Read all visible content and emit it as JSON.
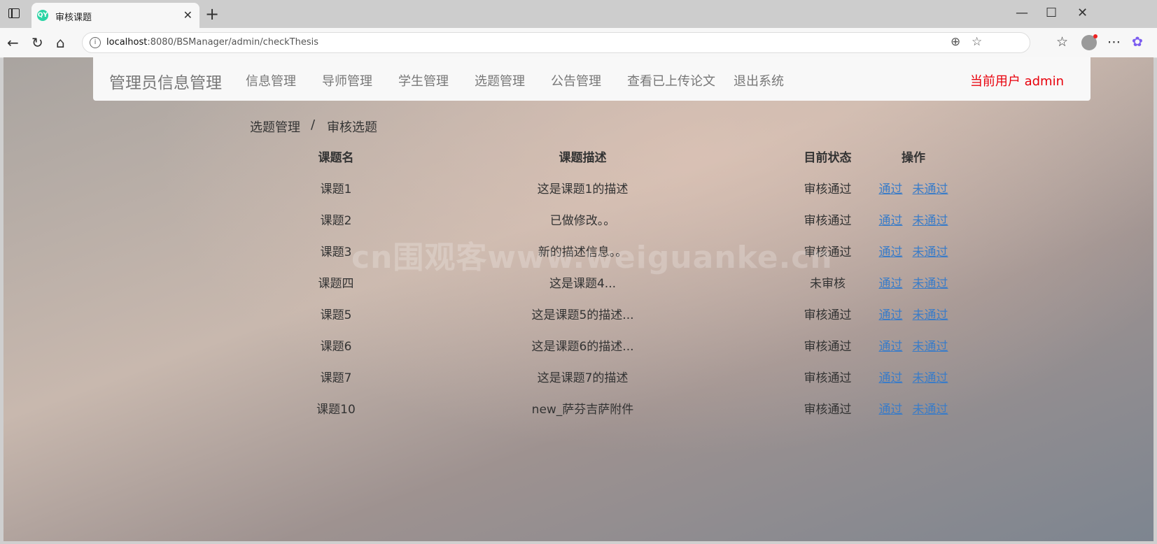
{
  "browser": {
    "tab_title": "审核课题",
    "favicon_text": "QY",
    "url_host": "localhost",
    "url_rest": ":8080/BSManager/admin/checkThesis"
  },
  "nav": {
    "brand": "管理员信息管理",
    "items": [
      "信息管理",
      "导师管理",
      "学生管理",
      "选题管理",
      "公告管理",
      "查看已上传论文",
      "退出系统"
    ],
    "current_user": "当前用户 admin"
  },
  "breadcrumb": {
    "first": "选题管理",
    "separator": "/",
    "second": "审核选题"
  },
  "table": {
    "headers": [
      "课题名",
      "课题描述",
      "目前状态",
      "操作"
    ],
    "rows": [
      {
        "name": "课题1",
        "desc": "这是课题1的描述",
        "status": "审核通过"
      },
      {
        "name": "课题2",
        "desc": "已做修改。。",
        "status": "审核通过"
      },
      {
        "name": "课题3",
        "desc": "新的描述信息。。",
        "status": "审核通过"
      },
      {
        "name": "课题四",
        "desc": "这是课题4...",
        "status": "未审核"
      },
      {
        "name": "课题5",
        "desc": "这是课题5的描述...",
        "status": "审核通过"
      },
      {
        "name": "课题6",
        "desc": "这是课题6的描述...",
        "status": "审核通过"
      },
      {
        "name": "课题7",
        "desc": "这是课题7的描述",
        "status": "审核通过"
      },
      {
        "name": "课题10",
        "desc": "new_萨芬吉萨附件",
        "status": "审核通过"
      }
    ],
    "approve_label": "通过",
    "reject_label": "未通过"
  },
  "watermark": "cn围观客www.weiguanke.cn",
  "colors": {
    "user": "#e8000b",
    "link": "#3a7cc8"
  }
}
